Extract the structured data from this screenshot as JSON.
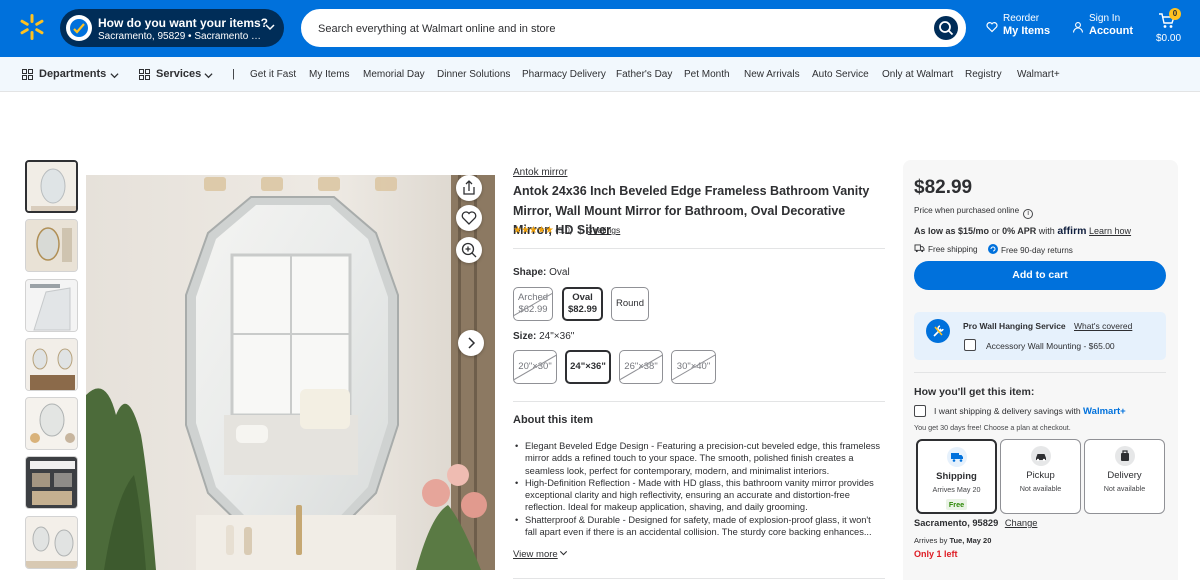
{
  "header": {
    "delivery_title": "How do you want your items?",
    "delivery_location": "Sacramento, 95829 • Sacramento Supe...",
    "search_placeholder": "Search everything at Walmart online and in store",
    "reorder_top": "Reorder",
    "reorder_bottom": "My Items",
    "account_top": "Sign In",
    "account_bottom": "Account",
    "cart_count": "0",
    "cart_total": "$0.00",
    "brand_color": "#0071dc",
    "accent_color": "#ffc220"
  },
  "nav": {
    "departments": "Departments",
    "services": "Services",
    "separator": "|",
    "links": [
      "Get it Fast",
      "My Items",
      "Memorial Day",
      "Dinner Solutions",
      "Pharmacy Delivery",
      "Father's Day",
      "Pet Month",
      "New Arrivals",
      "Auto Service",
      "Only at Walmart",
      "Registry",
      "Walmart+"
    ]
  },
  "product": {
    "brand": "Antok mirror",
    "title": "Antok 24x36 Inch Beveled Edge Frameless Bathroom Vanity Mirror, Wall Mount Mirror for Bathroom, Oval Decorative Mirror, HD Silver",
    "stars": "★★★★★",
    "rating_value": "(5.0)",
    "rating_sep": "|",
    "ratings_count": "3 ratings",
    "shape_label": "Shape:",
    "shape_value": "Oval",
    "shapes": [
      {
        "name": "Arched",
        "price": "$62.99"
      },
      {
        "name": "Oval",
        "price": "$82.99"
      },
      {
        "name": "Round",
        "price": ""
      }
    ],
    "size_label": "Size:",
    "size_value": "24\"×36\"",
    "sizes": [
      "20\"×30\"",
      "24\"×36\"",
      "26\"×38\"",
      "30\"×40\""
    ],
    "about_title": "About this item",
    "bullets": [
      "Elegant Beveled Edge Design - Featuring a precision-cut beveled edge, this frameless mirror adds a refined touch to your space. The smooth, polished finish creates a seamless look, perfect for contemporary, modern, and minimalist interiors.",
      "High-Definition Reflection - Made with HD glass, this bathroom vanity mirror provides exceptional clarity and high reflectivity, ensuring an accurate and distortion-free reflection. Ideal for makeup application, shaving, and daily grooming.",
      "Shatterproof & Durable - Designed for safety, made of explosion-proof glass, it won't fall apart even if there is an accidental collision. The sturdy core backing enhances..."
    ],
    "view_more": "View more"
  },
  "buybox": {
    "price": "$82.99",
    "price_note": "Price when purchased online",
    "affirm_low": "As low as $15/mo",
    "affirm_or": "or",
    "affirm_apr": "0% APR",
    "affirm_with": "with",
    "affirm_brand": "affirm",
    "affirm_learn": "Learn how",
    "free_shipping": "Free shipping",
    "free_returns": "Free 90-day returns",
    "add_to_cart": "Add to cart",
    "pro_title": "Pro Wall Hanging Service",
    "whats_covered": "What's covered",
    "accessory": "Accessory Wall Mounting - $65.00",
    "how_get": "How you'll get this item:",
    "wplus_text": "I want shipping & delivery savings with",
    "wplus_brand": "Walmart+",
    "trial": "You get 30 days free! Choose a plan at checkout.",
    "fulfillment": [
      {
        "name": "Shipping",
        "sub": "Arrives May 20",
        "tag": "Free"
      },
      {
        "name": "Pickup",
        "sub": "Not available",
        "tag": ""
      },
      {
        "name": "Delivery",
        "sub": "Not available",
        "tag": ""
      }
    ],
    "location": "Sacramento, 95829",
    "change": "Change",
    "arrives_prefix": "Arrives by",
    "arrives_date": "Tue, May 20",
    "stock": "Only 1 left"
  }
}
